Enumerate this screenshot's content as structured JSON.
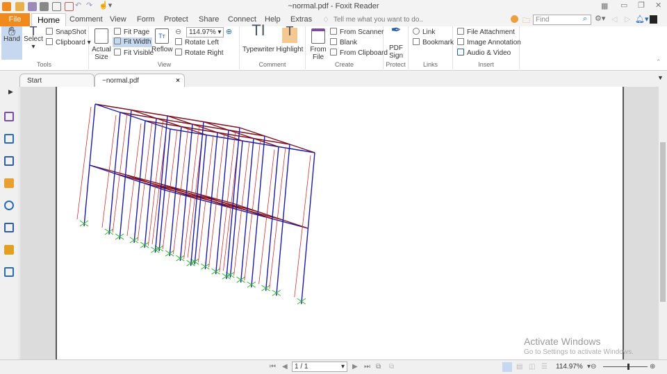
{
  "window": {
    "title": "~normal.pdf - Foxit Reader"
  },
  "menu_tabs": [
    {
      "label": "File"
    },
    {
      "label": "Home"
    },
    {
      "label": "Comment"
    },
    {
      "label": "View"
    },
    {
      "label": "Form"
    },
    {
      "label": "Protect"
    },
    {
      "label": "Share"
    },
    {
      "label": "Connect"
    },
    {
      "label": "Help"
    },
    {
      "label": "Extras"
    }
  ],
  "tell_me": {
    "placeholder": "Tell me what you want to do.."
  },
  "find": {
    "placeholder": "Find"
  },
  "ribbon": {
    "tools": {
      "label": "Tools",
      "hand": "Hand",
      "select": "Select",
      "snapshot": "SnapShot",
      "clipboard": "Clipboard"
    },
    "view": {
      "label": "View",
      "actual_size": "Actual Size",
      "fit_page": "Fit Page",
      "fit_width": "Fit Width",
      "fit_visible": "Fit Visible",
      "reflow": "Reflow",
      "zoom": "114.97%",
      "rotate_left": "Rotate Left",
      "rotate_right": "Rotate Right"
    },
    "comment": {
      "label": "Comment",
      "typewriter": "Typewriter",
      "highlight": "Highlight"
    },
    "create": {
      "label": "Create",
      "from_file": "From File",
      "from_scanner": "From Scanner",
      "blank": "Blank",
      "from_clipboard": "From Clipboard"
    },
    "protect": {
      "label": "Protect",
      "pdf_sign": "PDF Sign"
    },
    "links": {
      "label": "Links",
      "link": "Link",
      "bookmark": "Bookmark"
    },
    "insert": {
      "label": "Insert",
      "file_attachment": "File Attachment",
      "image_annotation": "Image Annotation",
      "audio_video": "Audio & Video"
    }
  },
  "doc_tabs": [
    {
      "label": "Start"
    },
    {
      "label": "~normal.pdf",
      "close": "×"
    }
  ],
  "status": {
    "page": "1 / 1",
    "zoom": "114.97%",
    "zoom_fraction": 0.55
  },
  "watermark": {
    "line1": "Activate Windows",
    "line2": "Go to Settings to activate Windows."
  },
  "colors": {
    "accent": "#f08a1c",
    "beam": "#7a1020",
    "column": "#1a1aa8",
    "support": "#2bb52b"
  }
}
